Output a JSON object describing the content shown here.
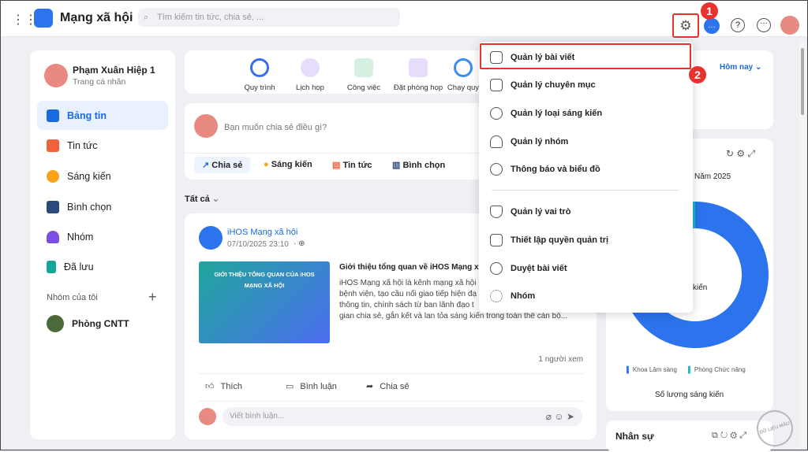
{
  "app": {
    "title": "Mạng xã hội",
    "search_placeholder": "Tìm kiếm tin tức, chia sẻ, ..."
  },
  "header_icons": [
    "apps-grid-icon",
    "gear-icon",
    "chat-icon",
    "help-icon",
    "more-icon",
    "avatar"
  ],
  "callouts": {
    "one": "1",
    "two": "2"
  },
  "profile": {
    "name": "Phạm Xuân Hiệp 1",
    "subtitle": "Trang cá nhân"
  },
  "sidebar": {
    "items": [
      {
        "label": "Bảng tin",
        "active": true,
        "color": "#1a6be0"
      },
      {
        "label": "Tin tức",
        "color": "#f0623a"
      },
      {
        "label": "Sáng kiến",
        "color": "#f7a21b"
      },
      {
        "label": "Bình chọn",
        "color": "#2a4a7a"
      },
      {
        "label": "Nhóm",
        "color": "#7a4ee0"
      },
      {
        "label": "Đã lưu",
        "color": "#14a69b"
      }
    ],
    "groups_title": "Nhóm của tôi",
    "groups": [
      {
        "label": "Phòng CNTT"
      }
    ]
  },
  "quick_links": [
    {
      "label": "Quy trình",
      "color": "#3b6cf0"
    },
    {
      "label": "Lịch họp",
      "color": "#8a5ef0"
    },
    {
      "label": "Công việc",
      "color": "#2aa06a"
    },
    {
      "label": "Đặt phòng họp",
      "color": "#9b5ef0"
    },
    {
      "label": "Chạy quy",
      "color": "#3b8cf0"
    }
  ],
  "composer": {
    "placeholder": "Bạn muốn chia sẻ điều gì?",
    "actions": [
      "Chia sẻ",
      "Sáng kiến",
      "Tin tức",
      "Bình chọn"
    ]
  },
  "filter": {
    "label": "Tất cả"
  },
  "post": {
    "author": "iHOS Mạng xã hội",
    "time": "07/10/2025 23:10",
    "image_title": "GIỚI THIỆU TỔNG QUAN CỦA iHOS MẠNG XÃ HỘI",
    "title": "Giới thiệu tổng quan về iHOS Mạng xã",
    "body": [
      "iHOS Mạng xã hội là kênh mạng xã hội",
      "bệnh viện, tạo cầu nối giao tiếp hiện đạ",
      "thông tin, chính sách từ ban lãnh đạo t",
      "gian chia sẻ, gắn kết và lan tỏa sáng kiến trong toàn thể cán bộ..."
    ],
    "views": "1 người xem",
    "like": "Thích",
    "comment": "Bình luận",
    "share": "Chia sẻ",
    "comment_placeholder": "Viết bình luận..."
  },
  "right": {
    "period": "Hôm nay",
    "chart_year": "Năm 2025",
    "chart_center": "kiến",
    "chart_footer": "Số lượng sáng kiến",
    "staff_title": "Nhân sự"
  },
  "chart_data": {
    "type": "pie",
    "series": [
      {
        "name": "Khoa Lâm sàng",
        "value": 97,
        "color": "#2b74ed"
      },
      {
        "name": "Phòng Chức năng",
        "value": 3,
        "color": "#1fb5c4"
      }
    ],
    "legend": "bottom"
  },
  "menu": {
    "items": [
      "Quản lý bài viết",
      "Quản lý chuyên mục",
      "Quản lý loại sáng kiến",
      "Quản lý nhóm",
      "Thông báo và biểu đồ",
      "Quản lý vai trò",
      "Thiết lập quyền quản trị",
      "Duyệt bài viết",
      "Nhóm"
    ],
    "highlight": "Quản lý bài viết"
  },
  "watermark": "DỮ LIỆU MẪU"
}
